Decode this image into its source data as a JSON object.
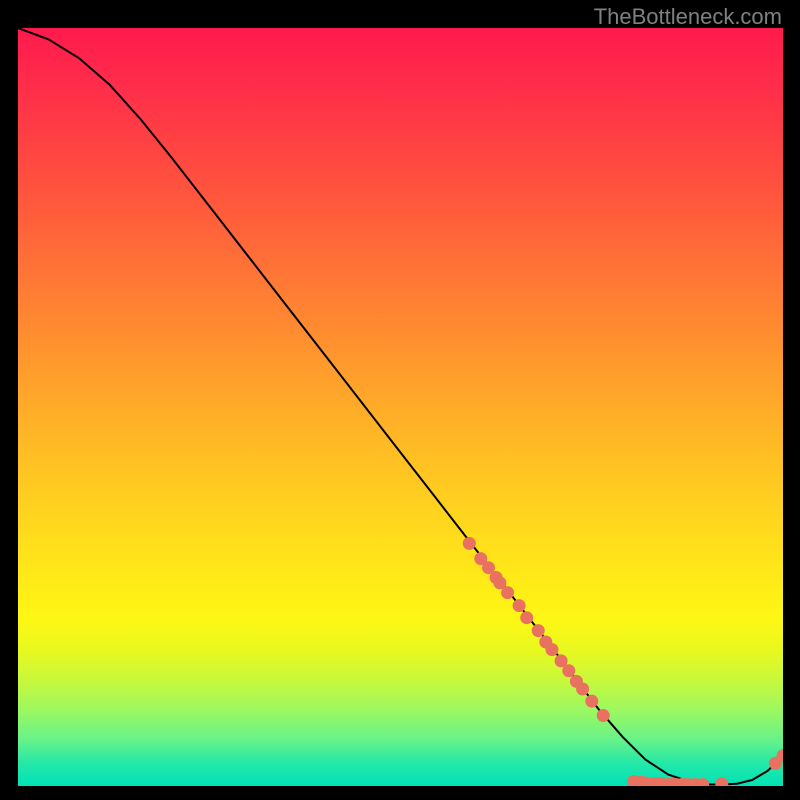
{
  "attribution": "TheBottleneck.com",
  "chart_data": {
    "type": "line",
    "title": "",
    "xlabel": "",
    "ylabel": "",
    "xlim": [
      0,
      100
    ],
    "ylim": [
      0,
      100
    ],
    "series": [
      {
        "name": "curve",
        "x": [
          0,
          4,
          8,
          12,
          16,
          20,
          25,
          30,
          35,
          40,
          45,
          50,
          55,
          60,
          65,
          70,
          73,
          76,
          79,
          82,
          85,
          88,
          90,
          92,
          94,
          96,
          98,
          100
        ],
        "y": [
          100,
          98.5,
          96,
          92.5,
          88,
          83,
          76.5,
          70,
          63.5,
          57,
          50.5,
          44,
          37.5,
          31,
          24.5,
          18,
          14,
          10,
          6.5,
          3.5,
          1.5,
          0.5,
          0.2,
          0.2,
          0.3,
          0.8,
          2,
          4
        ]
      }
    ],
    "points": [
      {
        "x": 59.0,
        "y": 32.0
      },
      {
        "x": 60.5,
        "y": 30.0
      },
      {
        "x": 61.5,
        "y": 28.8
      },
      {
        "x": 62.5,
        "y": 27.5
      },
      {
        "x": 63.0,
        "y": 26.8
      },
      {
        "x": 64.0,
        "y": 25.5
      },
      {
        "x": 65.5,
        "y": 23.8
      },
      {
        "x": 66.5,
        "y": 22.2
      },
      {
        "x": 68.0,
        "y": 20.5
      },
      {
        "x": 69.0,
        "y": 19.0
      },
      {
        "x": 69.8,
        "y": 18.0
      },
      {
        "x": 71.0,
        "y": 16.5
      },
      {
        "x": 72.0,
        "y": 15.2
      },
      {
        "x": 73.0,
        "y": 13.8
      },
      {
        "x": 73.8,
        "y": 12.8
      },
      {
        "x": 75.0,
        "y": 11.2
      },
      {
        "x": 76.5,
        "y": 9.3
      },
      {
        "x": 80.5,
        "y": 0.6
      },
      {
        "x": 81.5,
        "y": 0.5
      },
      {
        "x": 82.0,
        "y": 0.4
      },
      {
        "x": 83.0,
        "y": 0.3
      },
      {
        "x": 83.5,
        "y": 0.3
      },
      {
        "x": 84.0,
        "y": 0.3
      },
      {
        "x": 84.8,
        "y": 0.2
      },
      {
        "x": 85.5,
        "y": 0.2
      },
      {
        "x": 86.0,
        "y": 0.2
      },
      {
        "x": 86.8,
        "y": 0.2
      },
      {
        "x": 87.5,
        "y": 0.2
      },
      {
        "x": 88.5,
        "y": 0.2
      },
      {
        "x": 89.5,
        "y": 0.2
      },
      {
        "x": 92.0,
        "y": 0.3
      },
      {
        "x": 99.0,
        "y": 3.0
      },
      {
        "x": 100.0,
        "y": 4.0
      }
    ],
    "gradient_note": "vertical red-yellow-green background represents bottleneck zones"
  }
}
